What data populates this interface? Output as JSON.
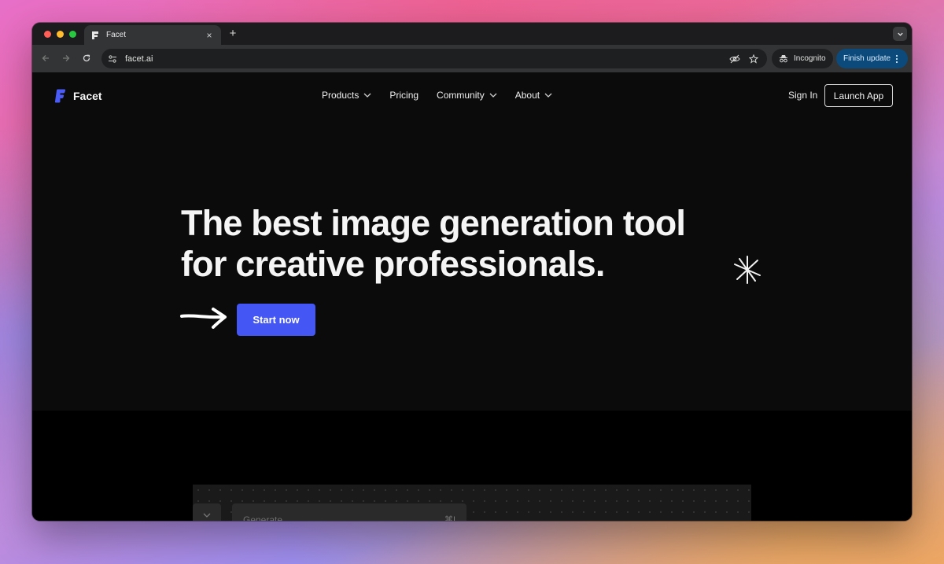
{
  "browser": {
    "tab_title": "Facet",
    "tab_close": "×",
    "new_tab": "+",
    "url": "facet.ai",
    "incognito_label": "Incognito",
    "finish_update_label": "Finish update"
  },
  "site": {
    "brand_name": "Facet",
    "brand_color": "#4a5cf5",
    "nav": [
      {
        "label": "Products",
        "has_dropdown": true
      },
      {
        "label": "Pricing",
        "has_dropdown": false
      },
      {
        "label": "Community",
        "has_dropdown": true
      },
      {
        "label": "About",
        "has_dropdown": true
      }
    ],
    "sign_in_label": "Sign In",
    "launch_label": "Launch App"
  },
  "hero": {
    "headline_line1": "The best image generation tool",
    "headline_line2": "for creative professionals.",
    "cta_label": "Start now",
    "cta_color": "#4457f5"
  },
  "preview": {
    "input_placeholder": "Generate",
    "shortcut": "⌘I"
  }
}
